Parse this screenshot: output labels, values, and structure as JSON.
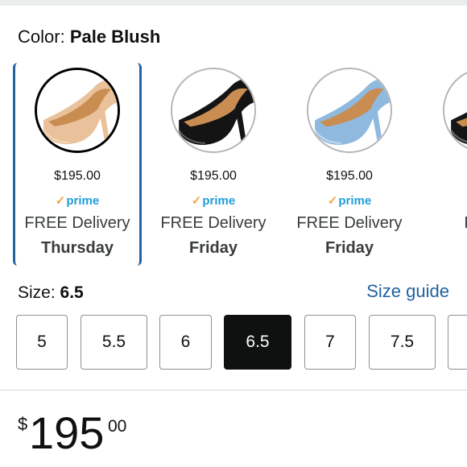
{
  "color": {
    "label": "Color:",
    "value": "Pale Blush"
  },
  "swatches": [
    {
      "price": "$195.00",
      "prime_check": "✓",
      "prime_label": "prime",
      "delivery": "FREE Delivery",
      "day": "Thursday",
      "selected": true,
      "shoe_color": "#e9c19a",
      "accent": "#f2d7b8"
    },
    {
      "price": "$195.00",
      "prime_check": "✓",
      "prime_label": "prime",
      "delivery": "FREE Delivery",
      "day": "Friday",
      "selected": false,
      "shoe_color": "#141414",
      "accent": "#5b5b5b"
    },
    {
      "price": "$195.00",
      "prime_check": "✓",
      "prime_label": "prime",
      "delivery": "FREE Delivery",
      "day": "Friday",
      "selected": false,
      "shoe_color": "#8fb9df",
      "accent": "#c3dbf0"
    },
    {
      "price": "$",
      "prime_check": "✓",
      "prime_label": "",
      "delivery": "FREE",
      "day": "F",
      "selected": false,
      "shoe_color": "#151515",
      "accent": "#6a6a6a"
    }
  ],
  "size": {
    "label": "Size:",
    "value": "6.5",
    "guide_label": "Size guide"
  },
  "sizes": [
    "5",
    "5.5",
    "6",
    "6.5",
    "7",
    "7.5",
    ""
  ],
  "selected_size": "6.5",
  "price": {
    "symbol": "$",
    "whole": "195",
    "fraction": "00"
  },
  "colors": {
    "link": "#2162a1",
    "prime": "#1f9ed8",
    "prime_check": "#f3a847",
    "selected_size_bg": "#0f1111",
    "selected_swatch_border": "#2162a1"
  }
}
